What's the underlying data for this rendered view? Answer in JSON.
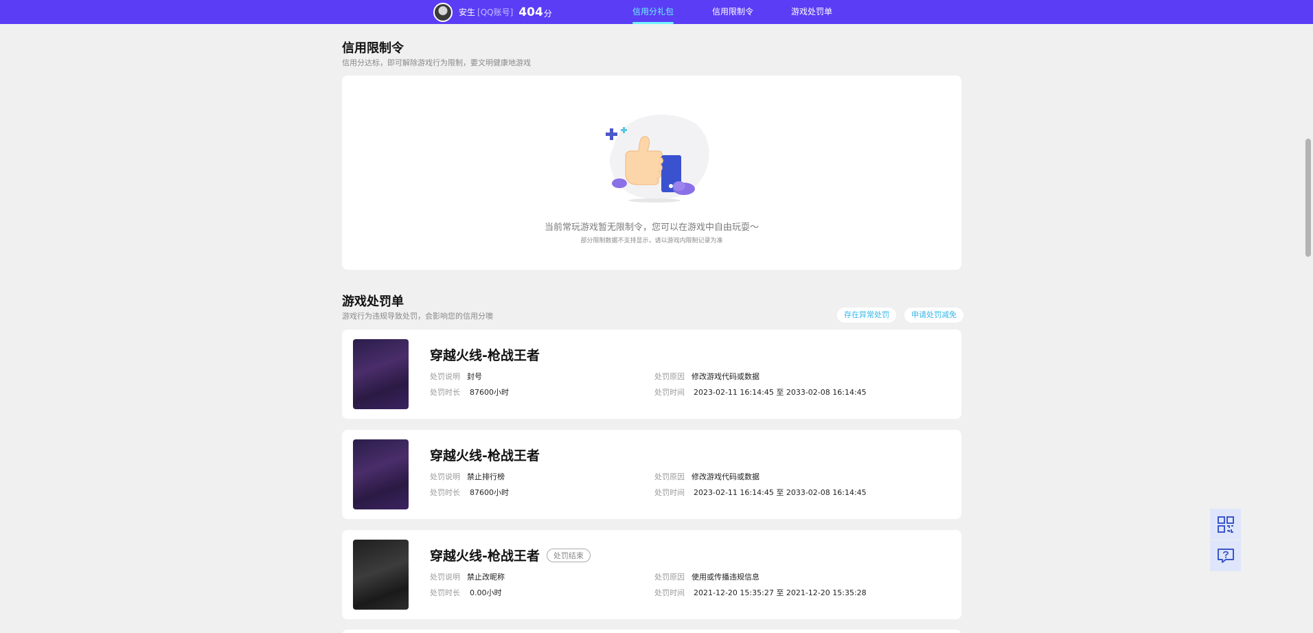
{
  "header": {
    "user_name": "安生",
    "account_type": "[QQ账号]",
    "score": "404",
    "score_unit": "分",
    "tabs": [
      {
        "label": "信用分礼包",
        "active": true
      },
      {
        "label": "信用限制令",
        "active": false
      },
      {
        "label": "游戏处罚单",
        "active": false
      }
    ]
  },
  "restriction": {
    "title": "信用限制令",
    "subtitle": "信用分达标，即可解除游戏行为限制，要文明健康地游戏",
    "empty_message": "当前常玩游戏暂无限制令，您可以在游戏中自由玩耍～",
    "empty_note": "部分限制数据不支持显示，请以游戏内限制记录为准"
  },
  "penalty": {
    "title": "游戏处罚单",
    "subtitle": "游戏行为违规导致处罚，会影响您的信用分噢",
    "actions": [
      "存在异常处罚",
      "申请处罚减免"
    ],
    "labels": {
      "desc": "处罚说明",
      "duration": "处罚时长",
      "reason": "处罚原因",
      "time": "处罚时间"
    },
    "items": [
      {
        "game": "穿越火线-枪战王者",
        "badge": "",
        "desc": "封号",
        "duration": "87600小时",
        "reason": "修改游戏代码或数据",
        "time": "2023-02-11 16:14:45 至 2033-02-08 16:14:45",
        "thumb_style": "purple"
      },
      {
        "game": "穿越火线-枪战王者",
        "badge": "",
        "desc": "禁止排行榜",
        "duration": "87600小时",
        "reason": "修改游戏代码或数据",
        "time": "2023-02-11 16:14:45 至 2033-02-08 16:14:45",
        "thumb_style": "purple"
      },
      {
        "game": "穿越火线-枪战王者",
        "badge": "处罚结束",
        "desc": "禁止改昵称",
        "duration": "0.00小时",
        "reason": "使用或传播违规信息",
        "time": "2021-12-20 15:35:27 至 2021-12-20 15:35:28",
        "thumb_style": "gray"
      }
    ]
  },
  "float_buttons": [
    "qrcode-icon",
    "help-chat-icon"
  ],
  "colors": {
    "header_bg": "#5a3df5",
    "active_tab": "#6ff3ff",
    "page_bg": "#f0f0f0",
    "link": "#36b6e6"
  }
}
